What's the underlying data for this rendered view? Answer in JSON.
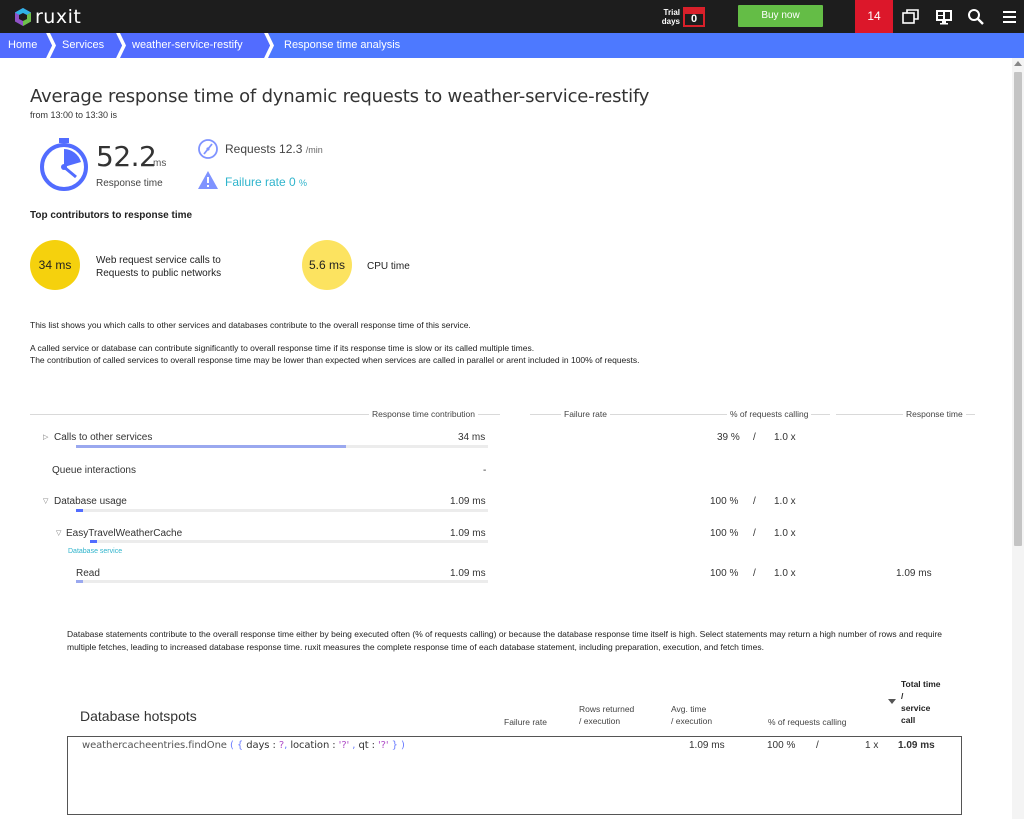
{
  "app": {
    "logo_text": "ruxit",
    "trial_label_1": "Trial",
    "trial_label_2": "days",
    "trial_days": "0",
    "buy_now": "Buy now",
    "notifications": "14"
  },
  "breadcrumb": [
    "Home",
    "Services",
    "weather-service-restify",
    "Response time analysis"
  ],
  "page": {
    "title": "Average response time of dynamic requests to weather-service-restify",
    "subtitle": "from 13:00 to 13:30 is",
    "response_time_value": "52.2",
    "response_time_unit": "ms",
    "response_time_label": "Response time",
    "requests_label": "Requests 12.3",
    "requests_unit": "/min",
    "failure_label": "Failure rate 0",
    "failure_unit": "%"
  },
  "top_contributors": {
    "heading": "Top contributors to response time",
    "items": [
      {
        "value": "34 ms",
        "label_1": "Web request service calls to",
        "label_2": "Requests to public networks"
      },
      {
        "value": "5.6 ms",
        "label_1": "CPU time",
        "label_2": ""
      }
    ]
  },
  "info": {
    "line1": "This list shows you which calls to other services and databases contribute to the overall response time of this service.",
    "line2": "A called service or database can contribute significantly to overall response time if its response time is slow or its called multiple times.",
    "line3": "The contribution of called services to overall response time may be lower than expected when services are called in parallel or arent included in 100% of requests."
  },
  "table": {
    "headers": [
      "Response time contribution",
      "Failure rate",
      "% of requests calling",
      "Response time"
    ],
    "rows": [
      {
        "name": "Calls to other services",
        "contribution": "34 ms",
        "fraction": 0.655,
        "pct": "39 %",
        "sep": "/",
        "count": "1.0 x",
        "rt": ""
      },
      {
        "name": "Queue interactions",
        "contribution": "-",
        "pct": "",
        "sep": "",
        "count": "",
        "rt": ""
      },
      {
        "name": "Database usage",
        "contribution": "1.09 ms",
        "fraction": 0.018,
        "pct": "100 %",
        "sep": "/",
        "count": "1.0 x",
        "rt": ""
      },
      {
        "name": "EasyTravelWeatherCache",
        "sub": "Database service",
        "contribution": "1.09 ms",
        "fraction": 0.018,
        "pct": "100 %",
        "sep": "/",
        "count": "1.0 x",
        "rt": ""
      },
      {
        "name": "Read",
        "contribution": "1.09 ms",
        "fraction": 0.018,
        "pct": "100 %",
        "sep": "/",
        "count": "1.0 x",
        "rt": "1.09 ms"
      }
    ]
  },
  "db_info": "Database statements contribute to the overall response time either by being executed often (% of requests calling) or because the database response time itself is high. Select statements may return a high number of rows and require multiple fetches, leading to increased database response time. ruxit measures the complete response time of each database statement, including preparation, execution, and fetch times.",
  "hotspots": {
    "title": "Database hotspots",
    "headers": {
      "failure": "Failure rate",
      "rows_1": "Rows returned",
      "rows_2": "/ execution",
      "avg_1": "Avg. time",
      "avg_2": "/ execution",
      "pct": "% of requests calling",
      "total_1": "Total time",
      "total_2": "/",
      "total_3": "service",
      "total_4": "call"
    },
    "statement": {
      "fn": "weathercacheentries.findOne",
      "open": "( {",
      "k1": "days",
      "c1": ":",
      "v1": "?",
      "s1": ",",
      "k2": "location",
      "c2": ":",
      "v2": "'?'",
      "s2": ",",
      "k3": "qt",
      "c3": ":",
      "v3": "'?'",
      "close": "} )"
    },
    "avg": "1.09 ms",
    "pct": "100 %",
    "sep": "/",
    "count": "1 x",
    "total": "1.09 ms"
  }
}
